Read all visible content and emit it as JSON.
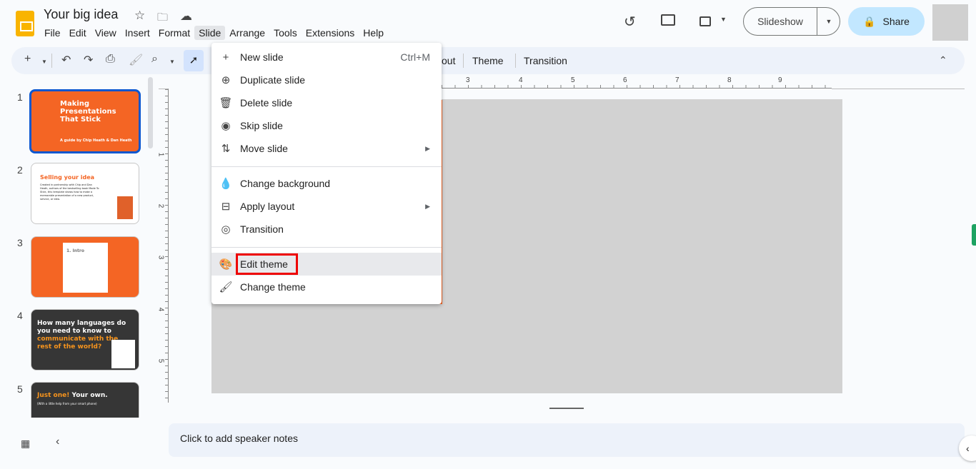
{
  "header": {
    "title": "Your big idea",
    "icons": [
      "star-icon",
      "move-to-folder-icon",
      "cloud-saved-icon"
    ],
    "menus": [
      "File",
      "Edit",
      "View",
      "Insert",
      "Format",
      "Slide",
      "Arrange",
      "Tools",
      "Extensions",
      "Help"
    ],
    "active_menu": "Slide",
    "right_icons": [
      "version-history-icon",
      "comments-icon",
      "meet-icon"
    ],
    "slideshow_label": "Slideshow",
    "share_label": "Share"
  },
  "toolbar": {
    "visible_tail": "out",
    "theme_label": "Theme",
    "transition_label": "Transition"
  },
  "ruler": {
    "h_ticks": [
      "3",
      "4",
      "5",
      "6",
      "7",
      "8",
      "9"
    ],
    "v_ticks": [
      "1",
      "2",
      "3",
      "4",
      "5"
    ]
  },
  "slides": [
    {
      "num": "1",
      "title": "Making Presentations That Stick",
      "subtitle": "A guide by Chip Heath & Dan Heath"
    },
    {
      "num": "2",
      "title": "Selling your idea",
      "body": "Created in partnership with Chip and Dan Heath, authors of the bestselling book Made To Stick, this template shows how to make a memorable presentation of a new product, service, or idea."
    },
    {
      "num": "3",
      "title": "1. Intro"
    },
    {
      "num": "4",
      "title_white": "How many languages do you need to know to",
      "title_orange": "communicate with the rest of the world?"
    },
    {
      "num": "5",
      "title_orange": "Just one!",
      "title_white": "Your own.",
      "subtitle": "(With a little help from your smart phone)"
    }
  ],
  "slide_menu": {
    "items": [
      {
        "label": "New slide",
        "icon": "plus-icon",
        "shortcut": "Ctrl+M"
      },
      {
        "label": "Duplicate slide",
        "icon": "duplicate-icon"
      },
      {
        "label": "Delete slide",
        "icon": "trash-icon"
      },
      {
        "label": "Skip slide",
        "icon": "eye-icon"
      },
      {
        "label": "Move slide",
        "icon": "move-icon",
        "submenu": true
      },
      {
        "label": "Change background",
        "icon": "fill-drop-icon"
      },
      {
        "label": "Apply layout",
        "icon": "layout-icon",
        "submenu": true
      },
      {
        "label": "Transition",
        "icon": "transition-icon"
      },
      {
        "label": "Edit theme",
        "icon": "palette-icon",
        "highlighted": true
      },
      {
        "label": "Change theme",
        "icon": "paint-roller-icon"
      }
    ]
  },
  "notes": {
    "placeholder": "Click to add speaker notes"
  },
  "colors": {
    "accent": "#0b57d0",
    "share_bg": "#c2e7ff",
    "slide_orange": "#f46524",
    "highlight_box": "#ee0000"
  }
}
